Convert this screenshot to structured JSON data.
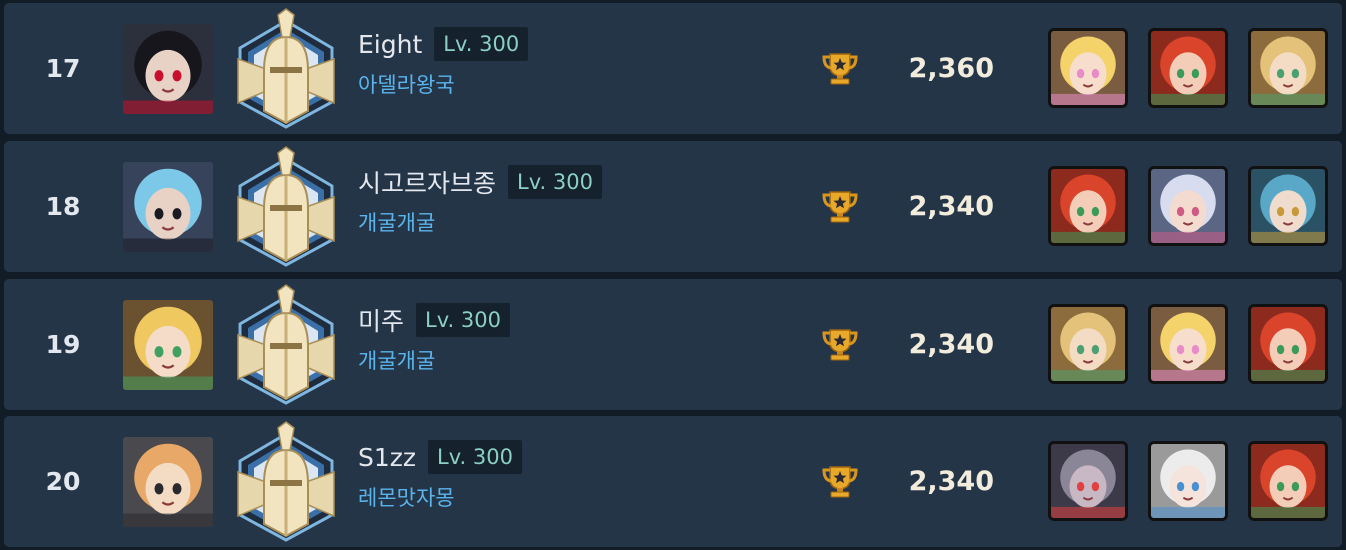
{
  "rows": [
    {
      "rank": "17",
      "player_name": "Eight",
      "level": "Lv. 300",
      "guild": "아델라왕국",
      "score": "2,360",
      "avatar": "dark-haired-girl-avatar",
      "avatar_colors": {
        "bg": "#2c2f3c",
        "hair": "#16161c",
        "skin": "#e8d2c6",
        "accent": "#c8102e"
      },
      "heroes": [
        {
          "icon": "blonde-pink-eyed-hero",
          "bg": "#7a5c40",
          "hair": "#f4d36a",
          "skin": "#f6ddcc",
          "accent": "#e88cc8"
        },
        {
          "icon": "red-haired-hero",
          "bg": "#8b2a1d",
          "hair": "#d9442a",
          "skin": "#f4cdb8",
          "accent": "#3a9a5a"
        },
        {
          "icon": "blonde-green-eyed-hero",
          "bg": "#8c6b3c",
          "hair": "#e4c27a",
          "skin": "#f4dbc4",
          "accent": "#4aa070"
        }
      ]
    },
    {
      "rank": "18",
      "player_name": "시고르자브종",
      "level": "Lv. 300",
      "guild": "개굴개굴",
      "score": "2,340",
      "avatar": "blue-haired-sunglasses-avatar",
      "avatar_colors": {
        "bg": "#37435a",
        "hair": "#7cc8e8",
        "skin": "#e8d2c6",
        "accent": "#1a1a22"
      },
      "heroes": [
        {
          "icon": "red-haired-hero",
          "bg": "#8b2a1d",
          "hair": "#d9442a",
          "skin": "#f4cdb8",
          "accent": "#3a9a5a"
        },
        {
          "icon": "silver-haired-hero",
          "bg": "#5a6684",
          "hair": "#d8dcef",
          "skin": "#f4dbd0",
          "accent": "#d05a86"
        },
        {
          "icon": "teal-haired-hero",
          "bg": "#2a5264",
          "hair": "#5aa8c8",
          "skin": "#f0dccc",
          "accent": "#c89a3a"
        }
      ]
    },
    {
      "rank": "19",
      "player_name": "미주",
      "level": "Lv. 300",
      "guild": "개굴개굴",
      "score": "2,340",
      "avatar": "blonde-cat-ear-avatar",
      "avatar_colors": {
        "bg": "#6a5230",
        "hair": "#f0c860",
        "skin": "#f4dcc8",
        "accent": "#3fa060"
      },
      "heroes": [
        {
          "icon": "blonde-green-eyed-hero",
          "bg": "#8c6b3c",
          "hair": "#e4c27a",
          "skin": "#f4dbc4",
          "accent": "#4aa070"
        },
        {
          "icon": "blonde-pink-eyed-hero",
          "bg": "#7a5c40",
          "hair": "#f4d36a",
          "skin": "#f6ddcc",
          "accent": "#e88cc8"
        },
        {
          "icon": "red-haired-hero",
          "bg": "#8b2a1d",
          "hair": "#d9442a",
          "skin": "#f4cdb8",
          "accent": "#3a9a5a"
        }
      ]
    },
    {
      "rank": "20",
      "player_name": "S1zz",
      "level": "Lv. 300",
      "guild": "레몬맛자몽",
      "score": "2,340",
      "avatar": "ginger-hooded-boy-avatar",
      "avatar_colors": {
        "bg": "#4a4a4e",
        "hair": "#e8a868",
        "skin": "#f4dcc4",
        "accent": "#2a2a2e"
      },
      "heroes": [
        {
          "icon": "grey-demon-hero",
          "bg": "#3c3a48",
          "hair": "#8a8698",
          "skin": "#c8b8c4",
          "accent": "#e04040"
        },
        {
          "icon": "white-haired-hero",
          "bg": "#9a9a9a",
          "hair": "#ececec",
          "skin": "#f4e4dc",
          "accent": "#4a90d0"
        },
        {
          "icon": "red-haired-hero",
          "bg": "#8b2a1d",
          "hair": "#d9442a",
          "skin": "#f4cdb8",
          "accent": "#3a9a5a"
        }
      ]
    }
  ]
}
